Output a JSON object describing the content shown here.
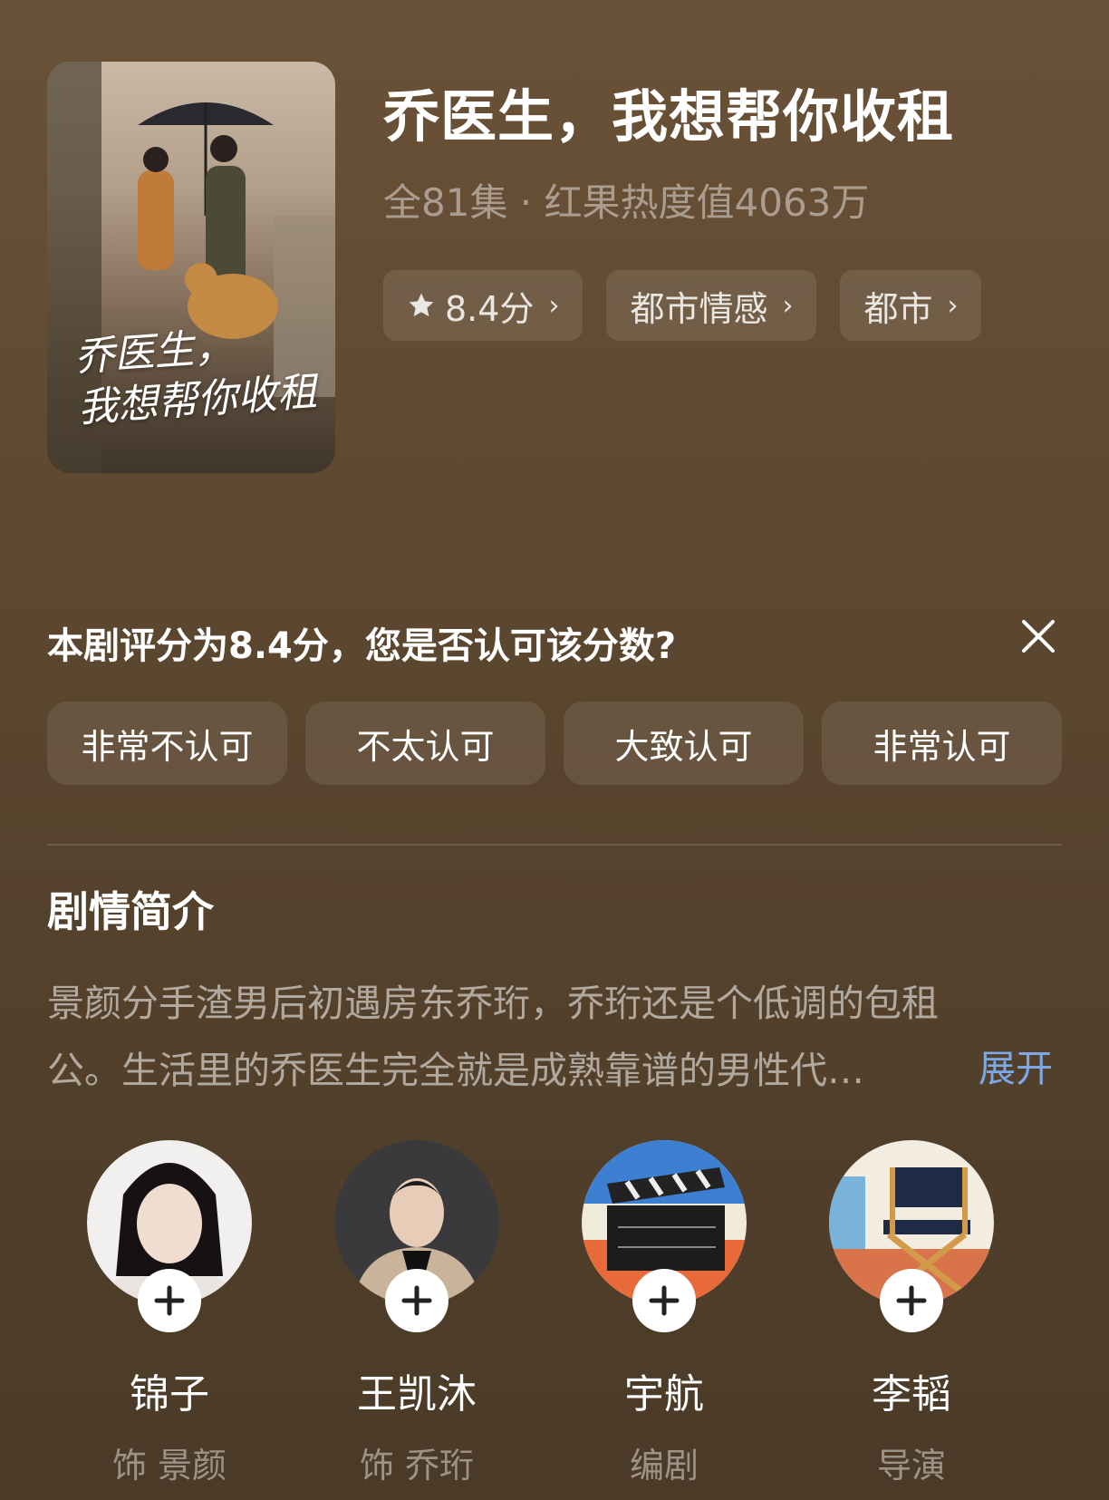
{
  "show": {
    "title": "乔医生，我想帮你收租",
    "subtitle": "全81集 · 红果热度值4063万",
    "poster_title": "乔医生，我想帮你收租"
  },
  "chips": [
    {
      "label": "8.4分",
      "icon": "star-icon"
    },
    {
      "label": "都市情感"
    },
    {
      "label": "都市"
    }
  ],
  "rating_prompt": {
    "question": "本剧评分为8.4分，您是否认可该分数?",
    "options": [
      "非常不认可",
      "不太认可",
      "大致认可",
      "非常认可"
    ]
  },
  "synopsis": {
    "heading": "剧情简介",
    "line1": "景颜分手渣男后初遇房东乔珩，乔珩还是个低调的包租",
    "line2": "公。生活里的乔医生完全就是成熟靠谱的男性代…",
    "expand_label": "展开"
  },
  "cast": [
    {
      "name": "锦子",
      "role": "饰 景颜"
    },
    {
      "name": "王凯沐",
      "role": "饰 乔珩"
    },
    {
      "name": "宇航",
      "role": "编剧"
    },
    {
      "name": "李韬",
      "role": "导演"
    }
  ],
  "colors": {
    "accent_link": "#7da8e8",
    "background": "#5e4830"
  }
}
